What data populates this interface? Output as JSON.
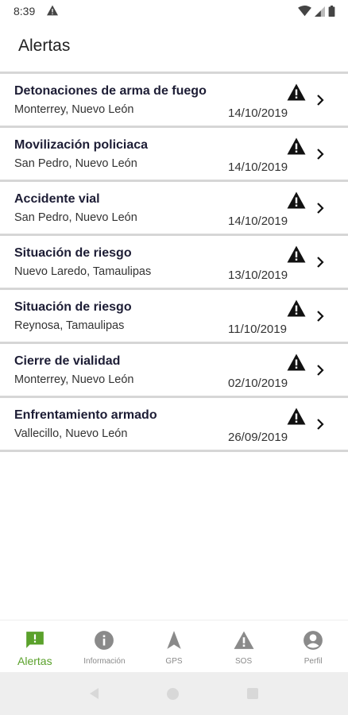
{
  "status_bar": {
    "time": "8:39"
  },
  "header": {
    "title": "Alertas"
  },
  "alerts": [
    {
      "title": "Detonaciones de arma de fuego",
      "location": "Monterrey, Nuevo León",
      "date": "14/10/2019"
    },
    {
      "title": "Movilización policiaca",
      "location": "San Pedro, Nuevo León",
      "date": "14/10/2019"
    },
    {
      "title": "Accidente vial",
      "location": "San Pedro, Nuevo León",
      "date": "14/10/2019"
    },
    {
      "title": "Situación de riesgo",
      "location": "Nuevo Laredo, Tamaulipas",
      "date": "13/10/2019"
    },
    {
      "title": "Situación de riesgo",
      "location": "Reynosa, Tamaulipas",
      "date": "11/10/2019"
    },
    {
      "title": "Cierre de vialidad",
      "location": "Monterrey, Nuevo León",
      "date": "02/10/2019"
    },
    {
      "title": "Enfrentamiento armado",
      "location": "Vallecillo, Nuevo León",
      "date": "26/09/2019"
    }
  ],
  "bottom_nav": [
    {
      "label": "Alertas",
      "icon": "alert-feedback-icon",
      "active": true
    },
    {
      "label": "Información",
      "icon": "info-icon",
      "active": false
    },
    {
      "label": "GPS",
      "icon": "navigation-arrow-icon",
      "active": false
    },
    {
      "label": "SOS",
      "icon": "warning-icon",
      "active": false
    },
    {
      "label": "Perfil",
      "icon": "account-circle-icon",
      "active": false
    }
  ],
  "colors": {
    "accent": "#5aa12b",
    "inactive": "#8a8a8a",
    "divider": "#d6d6d6",
    "title_text": "#1d1d35"
  }
}
